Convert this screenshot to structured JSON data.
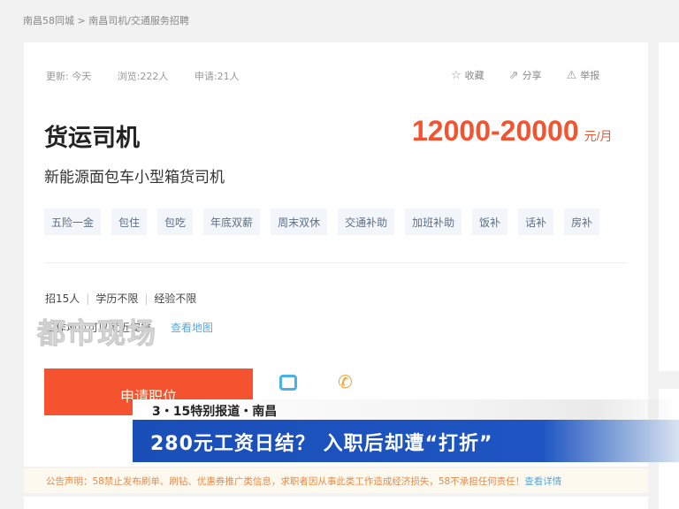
{
  "breadcrumb": "南昌58同城 > 南昌司机/交通服务招聘",
  "stats": {
    "update": "更新: 今天",
    "views": "浏览:222人",
    "applies": "申请:21人"
  },
  "actions": {
    "favorite": "收藏",
    "share": "分享",
    "report": "举报"
  },
  "job": {
    "title": "货运司机",
    "salary": "12000-20000",
    "salary_unit": "元/月",
    "subtitle": "新能源面包车小型箱货司机"
  },
  "tags": [
    "五险一金",
    "包住",
    "包吃",
    "年底双薪",
    "周末双休",
    "交通补助",
    "加班补助",
    "饭补",
    "话补",
    "房补"
  ],
  "requirements": [
    "招15人",
    "学历不限",
    "经验不限"
  ],
  "address": {
    "text": "工作地点可以就近安排",
    "map_link": "查看地图"
  },
  "watermark": "都市现场",
  "apply_label": "申请职位",
  "news": {
    "kicker": "3・15特别报道・南昌",
    "headline": "280元工资日结？ 入职后却遭“打折”"
  },
  "notice": {
    "text": "公告声明：58禁止发布刷单、刷钻、优惠券推广类信息，求职者因从事此类工作造成经济损失，58不承担任何责任！",
    "link": "查看详情"
  }
}
